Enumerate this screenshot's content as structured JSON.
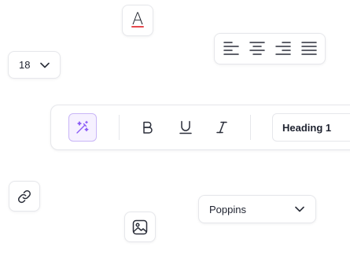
{
  "text_color": {
    "letter": "A",
    "underline_color": "#e5484d"
  },
  "align_group": {
    "options": [
      {
        "name": "align-left",
        "icon": "align-left-icon"
      },
      {
        "name": "align-center",
        "icon": "align-center-icon"
      },
      {
        "name": "align-right",
        "icon": "align-right-icon"
      },
      {
        "name": "align-justify",
        "icon": "align-justify-icon"
      }
    ]
  },
  "font_size": {
    "value": "18",
    "icon": "chevron-down-icon"
  },
  "toolbar": {
    "ai_button": {
      "icon": "magic-wand-icon",
      "accent": "#8b5cf6"
    },
    "bold_label": "B",
    "underline_label": "U",
    "italic_label": "I",
    "heading_value": "Heading 1"
  },
  "link_button": {
    "icon": "link-icon"
  },
  "font_family": {
    "value": "Poppins",
    "icon": "chevron-down-icon"
  },
  "image_button": {
    "icon": "image-icon"
  }
}
